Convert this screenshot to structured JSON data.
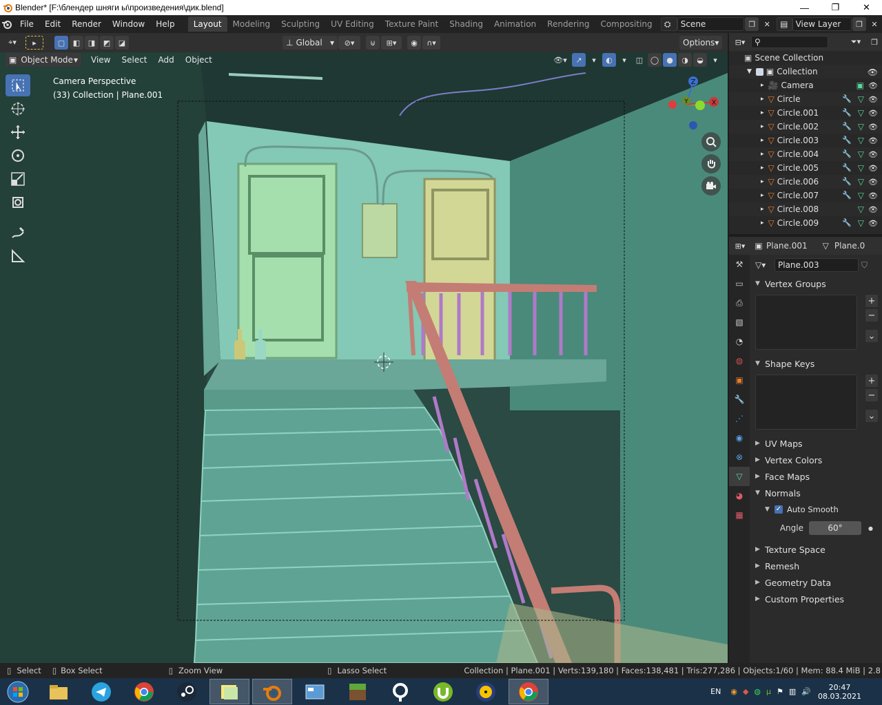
{
  "window": {
    "title": "Blender* [F:\\блендер шняги ы\\произведения\\дик.blend]",
    "min": "—",
    "max": "❐",
    "close": "✕"
  },
  "menu": [
    "File",
    "Edit",
    "Render",
    "Window",
    "Help"
  ],
  "workspaces": [
    "Layout",
    "Modeling",
    "Sculpting",
    "UV Editing",
    "Texture Paint",
    "Shading",
    "Animation",
    "Rendering",
    "Compositing"
  ],
  "scene": {
    "name": "Scene",
    "view_layer": "View Layer"
  },
  "viewport_header": {
    "transform_orientation": "Global",
    "options": "Options",
    "mode": "Object Mode",
    "menus": [
      "View",
      "Select",
      "Add",
      "Object"
    ]
  },
  "viewport": {
    "perspective": "Camera Perspective",
    "collection_info": "(33) Collection | Plane.001",
    "gizmo": {
      "z": "Z",
      "y": "Y",
      "x": "X"
    }
  },
  "outliner": {
    "root": "Scene Collection",
    "collection": "Collection",
    "items": [
      {
        "name": "Camera",
        "type": "camera"
      },
      {
        "name": "Circle",
        "type": "mesh"
      },
      {
        "name": "Circle.001",
        "type": "mesh"
      },
      {
        "name": "Circle.002",
        "type": "mesh"
      },
      {
        "name": "Circle.003",
        "type": "mesh"
      },
      {
        "name": "Circle.004",
        "type": "mesh"
      },
      {
        "name": "Circle.005",
        "type": "mesh"
      },
      {
        "name": "Circle.006",
        "type": "mesh"
      },
      {
        "name": "Circle.007",
        "type": "mesh"
      },
      {
        "name": "Circle.008",
        "type": "mesh"
      },
      {
        "name": "Circle.009",
        "type": "mesh"
      }
    ]
  },
  "properties": {
    "object": "Plane.001",
    "data_path": "Plane.0",
    "mesh_name": "Plane.003",
    "panels": {
      "vertex_groups": "Vertex Groups",
      "shape_keys": "Shape Keys",
      "uv_maps": "UV Maps",
      "vertex_colors": "Vertex Colors",
      "face_maps": "Face Maps",
      "normals": "Normals",
      "auto_smooth": "Auto Smooth",
      "angle_label": "Angle",
      "angle_value": "60°",
      "texture_space": "Texture Space",
      "remesh": "Remesh",
      "geometry_data": "Geometry Data",
      "custom_properties": "Custom Properties"
    }
  },
  "statusbar": {
    "select": "Select",
    "box_select": "Box Select",
    "zoom_view": "Zoom View",
    "lasso_select": "Lasso Select",
    "stats": "Collection | Plane.001 | Verts:139,180 | Faces:138,481 | Tris:277,286 | Objects:1/60 | Mem: 88.4 MiB | 2.8"
  },
  "taskbar": {
    "lang": "EN",
    "time": "20:47",
    "date": "08.03.2021"
  },
  "colors": {
    "accent": "#4772b3",
    "mesh_icon": "#e87d2a",
    "data_icon": "#5ed7a0",
    "room_wall": "#7ec4ae",
    "handrail": "#c37d74"
  }
}
